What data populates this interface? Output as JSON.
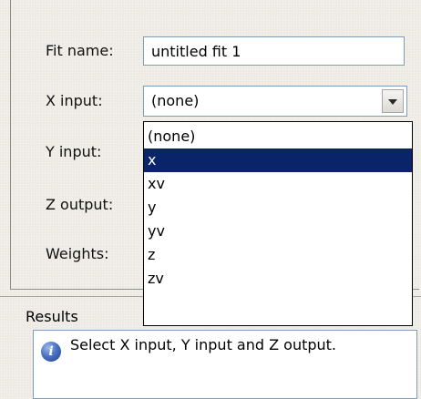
{
  "form": {
    "fit_name_label": "Fit name:",
    "fit_name_value": "untitled fit 1",
    "x_input_label": "X input:",
    "x_input_value": "(none)",
    "y_input_label": "Y input:",
    "z_output_label": "Z output:",
    "weights_label": "Weights:"
  },
  "dropdown": {
    "options": [
      {
        "label": "(none)",
        "selected": false
      },
      {
        "label": "x",
        "selected": true
      },
      {
        "label": "xv",
        "selected": false
      },
      {
        "label": "y",
        "selected": false
      },
      {
        "label": "yv",
        "selected": false
      },
      {
        "label": "z",
        "selected": false
      },
      {
        "label": "zv",
        "selected": false
      }
    ]
  },
  "results": {
    "title": "Results",
    "icon": "info-icon",
    "message": "Select X input, Y input and Z output."
  },
  "colors": {
    "selection_background": "#0a246a",
    "selection_text": "#ffffff",
    "panel_background": "#ede9e3",
    "field_border": "#7f9db9"
  }
}
